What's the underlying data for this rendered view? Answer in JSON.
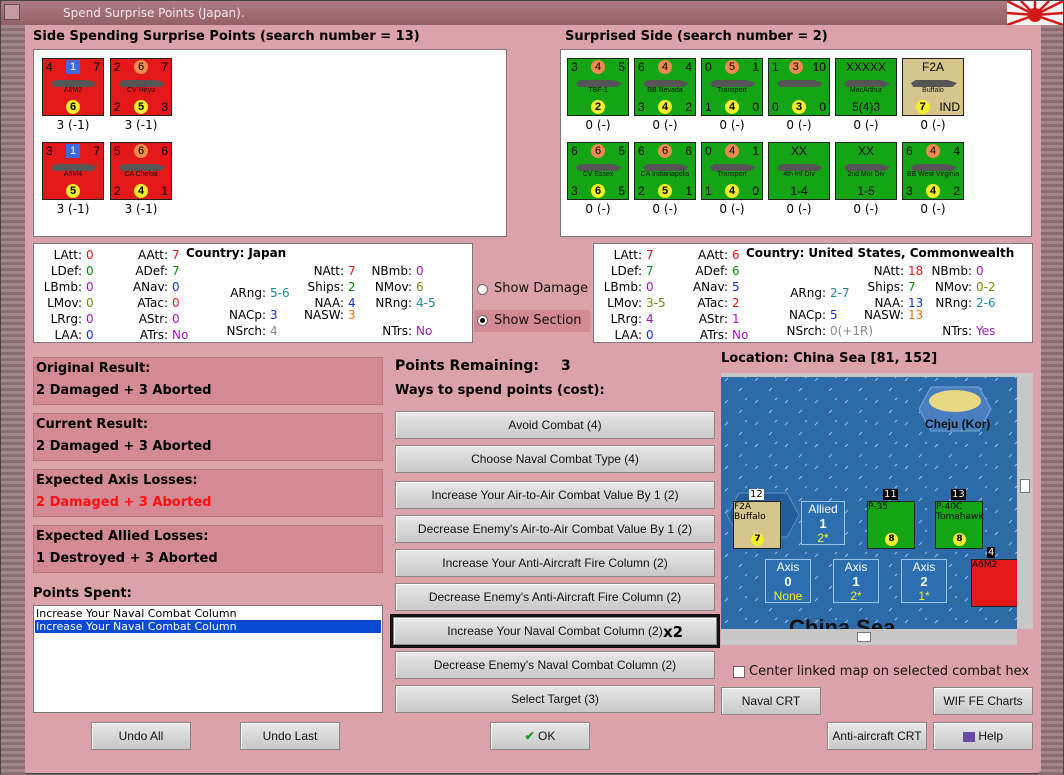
{
  "window": {
    "title": "Spend Surprise Points (Japan)."
  },
  "left_header": "Side Spending Surprise Points (search number = 13)",
  "right_header": "Surprised Side (search number = 2)",
  "left_units": [
    {
      "name": "A6M2",
      "top": [
        "4",
        "1",
        "7"
      ],
      "bottom": [
        "",
        "6",
        ""
      ],
      "caption": "3 (-1)",
      "color": "red"
    },
    {
      "name": "CV Hiryu",
      "top": [
        "2",
        "6",
        "7"
      ],
      "bottom": [
        "2",
        "5",
        "3"
      ],
      "caption": "3 (-1)",
      "color": "red"
    },
    {
      "name": "A5M4",
      "top": [
        "3",
        "1",
        "7"
      ],
      "bottom": [
        "",
        "5",
        ""
      ],
      "caption": "3 (-1)",
      "color": "red"
    },
    {
      "name": "CA Chokai",
      "top": [
        "5",
        "6",
        "6"
      ],
      "bottom": [
        "2",
        "4",
        "1"
      ],
      "caption": "3 (-1)",
      "color": "red"
    }
  ],
  "right_units": [
    {
      "name": "TBF-1",
      "top": [
        "3",
        "4",
        "5"
      ],
      "bottom": [
        "",
        "2",
        ""
      ],
      "caption": "0 (-)",
      "color": "green"
    },
    {
      "name": "BB Nevada",
      "top": [
        "6",
        "4",
        "4"
      ],
      "bottom": [
        "3",
        "4",
        "2"
      ],
      "caption": "0 (-)",
      "color": "green"
    },
    {
      "name": "Transport",
      "top": [
        "0",
        "5",
        "1"
      ],
      "bottom": [
        "1",
        "4",
        "0"
      ],
      "caption": "0 (-)",
      "color": "green"
    },
    {
      "name": "",
      "top": [
        "1",
        "3",
        "10"
      ],
      "bottom": [
        "0",
        "3",
        "0"
      ],
      "caption": "0 (-)",
      "color": "green"
    },
    {
      "name": "MacArthur",
      "top": [
        "",
        "XXXXX",
        ""
      ],
      "bottom": [
        "",
        "5(4)3",
        ""
      ],
      "caption": "0 (-)",
      "color": "green"
    },
    {
      "name": "Buffalo",
      "top": [
        "",
        "F2A",
        ""
      ],
      "bottom": [
        "",
        "7",
        "IND"
      ],
      "caption": "0 (-)",
      "color": "tan"
    },
    {
      "name": "CV Essex",
      "top": [
        "6",
        "6",
        "5"
      ],
      "bottom": [
        "3",
        "6",
        "5"
      ],
      "caption": "0 (-)",
      "color": "green"
    },
    {
      "name": "CA Indianapolis",
      "top": [
        "6",
        "6",
        "6"
      ],
      "bottom": [
        "2",
        "5",
        "1"
      ],
      "caption": "0 (-)",
      "color": "green"
    },
    {
      "name": "Transport",
      "top": [
        "0",
        "4",
        "1"
      ],
      "bottom": [
        "1",
        "4",
        "0"
      ],
      "caption": "0 (-)",
      "color": "green"
    },
    {
      "name": "4th Inf Div",
      "top": [
        "",
        "XX",
        ""
      ],
      "bottom": [
        "",
        "1-4",
        ""
      ],
      "caption": "0 (-)",
      "color": "green"
    },
    {
      "name": "2nd Mot Div",
      "top": [
        "",
        "XX",
        ""
      ],
      "bottom": [
        "",
        "1-5",
        ""
      ],
      "caption": "0 (-)",
      "color": "green"
    },
    {
      "name": "BB West Virginia",
      "top": [
        "6",
        "4",
        "4"
      ],
      "bottom": [
        "3",
        "4",
        "2"
      ],
      "caption": "0 (-)",
      "color": "green"
    }
  ],
  "left_stats": {
    "latt": "0",
    "ldef": "0",
    "lbmb": "0",
    "lmov": "0",
    "lrrg": "0",
    "laa": "0",
    "aatt": "7",
    "adef": "7",
    "anav": "0",
    "atac": "0",
    "astr": "0",
    "atrs": "No",
    "country_label": "Country:",
    "country": "Japan",
    "arng": "5-6",
    "nacp": "3",
    "nsrch": "4",
    "natt": "7",
    "ships": "2",
    "naa": "4",
    "nasw": "3",
    "nbmb": "0",
    "nmov": "6",
    "nrng": "4-5",
    "ntrs": "No"
  },
  "right_stats": {
    "latt": "7",
    "ldef": "7",
    "lbmb": "0",
    "lmov": "3-5",
    "lrrg": "4",
    "laa": "0",
    "aatt": "6",
    "adef": "6",
    "anav": "5",
    "atac": "2",
    "astr": "1",
    "atrs": "No",
    "country_label": "Country:",
    "country": "United States, Commonwealth",
    "arng": "2-7",
    "nacp": "5",
    "nsrch": "0(+1R)",
    "natt": "18",
    "ships": "7",
    "naa": "13",
    "nasw": "13",
    "nbmb": "0",
    "nmov": "0-2",
    "nrng": "2-6",
    "ntrs": "Yes"
  },
  "labels": {
    "latt": "LAtt:",
    "ldef": "LDef:",
    "lbmb": "LBmb:",
    "lmov": "LMov:",
    "lrrg": "LRrg:",
    "laa": "LAA:",
    "aatt": "AAtt:",
    "adef": "ADef:",
    "anav": "ANav:",
    "atac": "ATac:",
    "astr": "AStr:",
    "atrs": "ATrs:",
    "arng": "ARng:",
    "nacp": "NACp:",
    "nsrch": "NSrch:",
    "natt": "NAtt:",
    "ships": "Ships:",
    "naa": "NAA:",
    "nasw": "NASW:",
    "nbmb": "NBmb:",
    "nmov": "NMov:",
    "nrng": "NRng:",
    "ntrs": "NTrs:"
  },
  "options": {
    "show_damage": "Show Damage",
    "show_section": "Show Section"
  },
  "results": [
    {
      "title": "Original Result:",
      "value": "2 Damaged + 3 Aborted",
      "color": "#000000"
    },
    {
      "title": "Current Result:",
      "value": "2 Damaged + 3 Aborted",
      "color": "#000000"
    },
    {
      "title": "Expected Axis Losses:",
      "value": "2 Damaged + 3 Aborted",
      "color": "#ff1010"
    },
    {
      "title": "Expected Allied Losses:",
      "value": "1 Destroyed + 3 Aborted",
      "color": "#000000"
    }
  ],
  "points_spent": {
    "label": "Points Spent:",
    "items": [
      "Increase Your Naval Combat Column",
      "Increase Your Naval Combat Column"
    ]
  },
  "points_remaining": {
    "label": "Points Remaining:",
    "value": "3"
  },
  "ways_label": "Ways to spend points (cost):",
  "actions": [
    "Avoid Combat (4)",
    "Choose Naval Combat Type (4)",
    "Increase Your Air-to-Air Combat Value By 1 (2)",
    "Decrease Enemy's Air-to-Air Combat Value By 1 (2)",
    "Increase Your Anti-Aircraft Fire Column (2)",
    "Decrease Enemy's Anti-Aircraft Fire Column (2)",
    "Increase Your Naval Combat Column (2)",
    "Decrease Enemy's Naval Combat Column (2)",
    "Select Target (3)"
  ],
  "selected_multiplier": "x2",
  "location": "Location: China Sea [81, 152]",
  "map": {
    "island": "Cheju (Kor)",
    "sea": "China Sea",
    "allied": {
      "label": "Allied",
      "value": "1",
      "sub": "2*"
    },
    "axis": [
      {
        "label": "Axis",
        "value": "0",
        "sub": "None"
      },
      {
        "label": "Axis",
        "value": "1",
        "sub": "2*"
      },
      {
        "label": "Axis",
        "value": "2",
        "sub": "1*"
      }
    ],
    "stack_counts": [
      "12",
      "11",
      "13",
      "4"
    ],
    "units": [
      "F2A Buffalo",
      "P-35",
      "P-40C Tomahawk",
      "A6M2"
    ]
  },
  "center_linked": "Center linked map on selected combat hex",
  "buttons": {
    "undo_all": "Undo All",
    "undo_last": "Undo Last",
    "ok": "OK",
    "naval_crt": "Naval CRT",
    "wif_fe": "WIF FE Charts",
    "aa_crt": "Anti-aircraft CRT",
    "help": "Help"
  }
}
